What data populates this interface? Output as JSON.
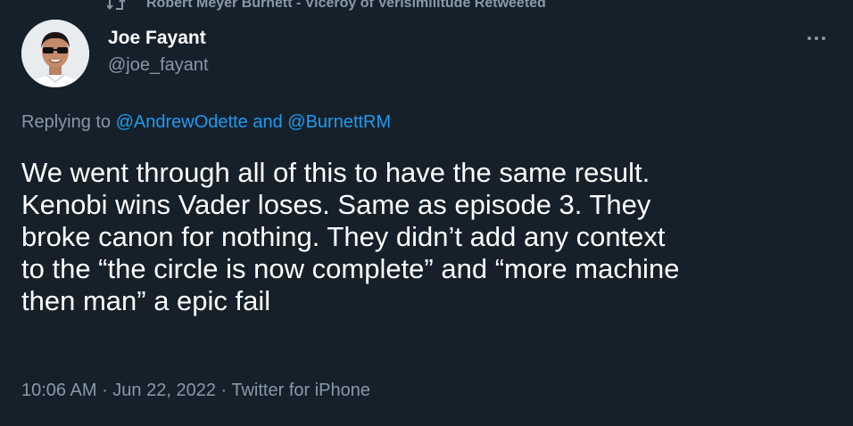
{
  "retweet_context": {
    "icon": "retweet-icon",
    "text": "Robert Meyer Burnett - Viceroy of Verisimilitude Retweeted"
  },
  "author": {
    "display_name": "Joe Fayant",
    "handle": "@joe_fayant",
    "avatar_icon": "avatar-photo"
  },
  "more_button": {
    "icon": "more-dots-icon"
  },
  "reply_context": {
    "prefix": "Replying to ",
    "mention_1": "@AndrewOdette",
    "conjunction": " and ",
    "mention_2": "@BurnettRM"
  },
  "tweet": {
    "lines": [
      "We went through all of this to have the same result.",
      "Kenobi wins Vader loses. Same as episode 3. They",
      "broke canon for nothing. They didn’t add any context",
      "to the “the circle is now complete” and “more machine",
      "then man” a epic fail"
    ]
  },
  "meta": {
    "time": "10:06 AM",
    "separator_1": " · ",
    "date": "Jun 22, 2022",
    "separator_2": " · ",
    "source": "Twitter for iPhone"
  },
  "colors": {
    "background": "#15202b",
    "primary_text": "#ffffff",
    "secondary_text": "#8899a6",
    "link": "#1d9bf0"
  }
}
